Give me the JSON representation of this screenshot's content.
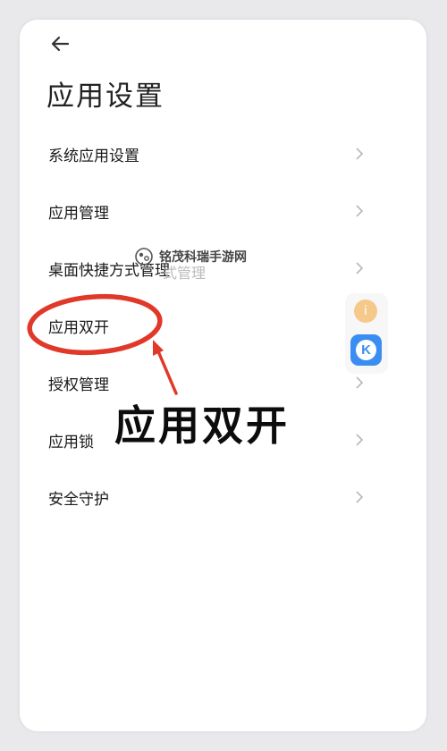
{
  "header": {
    "title": "应用设置",
    "back_icon": "arrow-left-icon"
  },
  "menu": {
    "items": [
      {
        "label": "系统应用设置"
      },
      {
        "label": "应用管理"
      },
      {
        "label": "桌面快捷方式管理"
      },
      {
        "label": "应用双开"
      },
      {
        "label": "授权管理"
      },
      {
        "label": "应用锁"
      },
      {
        "label": "安全守护"
      }
    ]
  },
  "annotation": {
    "caption": "应用双开",
    "highlight_color": "#e0392a",
    "highlighted_item": "应用双开"
  },
  "watermark": {
    "text": "铭茂科瑞手游网",
    "ghost_text": "式管理"
  },
  "floating": {
    "k_label": "K",
    "dot_label": "i"
  }
}
